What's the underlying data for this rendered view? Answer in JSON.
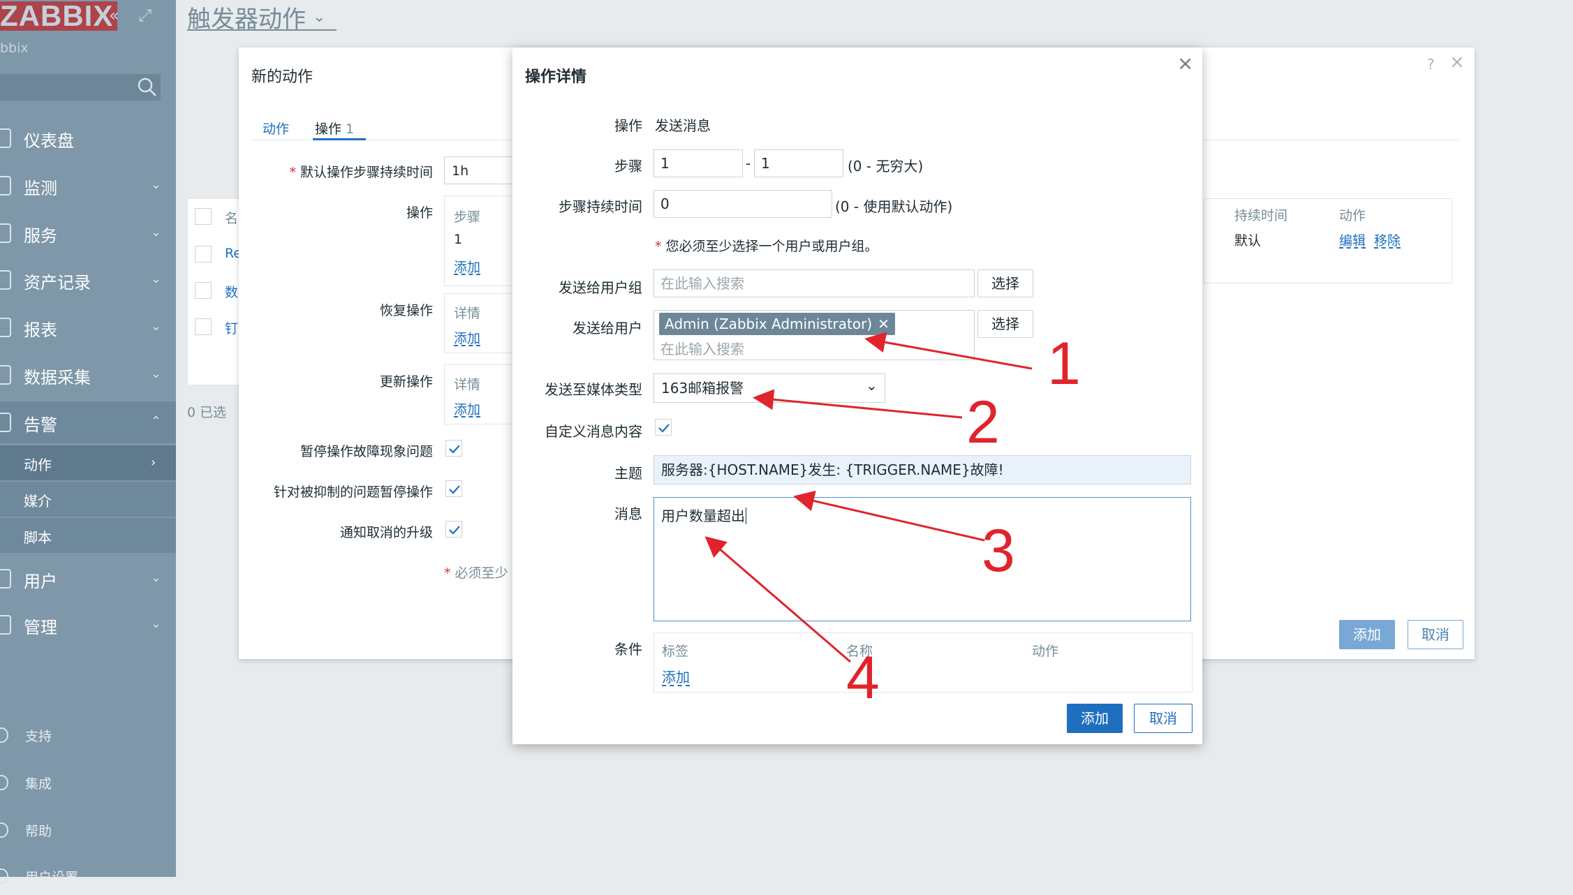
{
  "sidebar": {
    "logo": "ZABBIX",
    "server": "bbix",
    "nav": [
      {
        "label": "仪表盘"
      },
      {
        "label": "监测"
      },
      {
        "label": "服务"
      },
      {
        "label": "资产记录"
      },
      {
        "label": "报表"
      },
      {
        "label": "数据采集"
      },
      {
        "label": "告警"
      },
      {
        "label": "用户"
      },
      {
        "label": "管理"
      }
    ],
    "alerts_sub": [
      {
        "label": "动作"
      },
      {
        "label": "媒介"
      },
      {
        "label": "脚本"
      }
    ],
    "bottom": [
      {
        "label": "支持"
      },
      {
        "label": "集成"
      },
      {
        "label": "帮助"
      },
      {
        "label": "用户设置"
      }
    ]
  },
  "header": {
    "title": "触发器动作"
  },
  "bg_dialog": {
    "title": "新的动作",
    "help": "?",
    "tabs": [
      {
        "label": "动作"
      },
      {
        "label": "操作",
        "count": "1"
      }
    ],
    "default_duration_label": "默认操作步骤持续时间",
    "default_duration_value": "1h",
    "ops_label": "操作",
    "ops_step_header": "步骤",
    "ops_step_value": "1",
    "add_label": "添加",
    "recovery_label": "恢复操作",
    "update_label": "更新操作",
    "details_header": "详情",
    "pause_label": "暂停操作故障现象问题",
    "suppress_label": "针对被抑制的问题暂停操作",
    "notify_cancel_label": "通知取消的升级",
    "required_note": "必须至少",
    "duration_header": "持续时间",
    "action_header": "动作",
    "duration_value": "默认",
    "edit_link": "编辑",
    "remove_link": "移除",
    "add_button": "添加",
    "cancel_button": "取消",
    "list": {
      "name_col": "名",
      "rows": [
        "Re",
        "数",
        "钉"
      ],
      "selected": "0 已选"
    }
  },
  "dialog": {
    "title": "操作详情",
    "operation_label": "操作",
    "operation_value": "发送消息",
    "steps_label": "步骤",
    "step_from": "1",
    "step_sep": "-",
    "step_to": "1",
    "steps_hint": "(0 - 无穷大)",
    "step_duration_label": "步骤持续时间",
    "step_duration_value": "0",
    "step_duration_hint": "(0 - 使用默认动作)",
    "required_hint": "您必须至少选择一个用户或用户组。",
    "send_groups_label": "发送给用户组",
    "search_placeholder": "在此输入搜索",
    "select_button": "选择",
    "send_users_label": "发送给用户",
    "user_tag": "Admin (Zabbix Administrator)",
    "media_label": "发送至媒体类型",
    "media_value": "163邮箱报警",
    "custom_msg_label": "自定义消息内容",
    "custom_msg_checked": true,
    "subject_label": "主题",
    "subject_value": "服务器:{HOST.NAME}发生: {TRIGGER.NAME}故障!",
    "message_label": "消息",
    "message_value": "用户数量超出",
    "conditions_label": "条件",
    "cond_headers": [
      "标签",
      "名称",
      "动作"
    ],
    "cond_add": "添加",
    "add_button": "添加",
    "cancel_button": "取消"
  },
  "annotations": [
    "1",
    "2",
    "3",
    "4"
  ],
  "colors": {
    "accent": "#1f6fbf",
    "sidebar": "#7e97a9",
    "annotation": "#e0242b"
  }
}
